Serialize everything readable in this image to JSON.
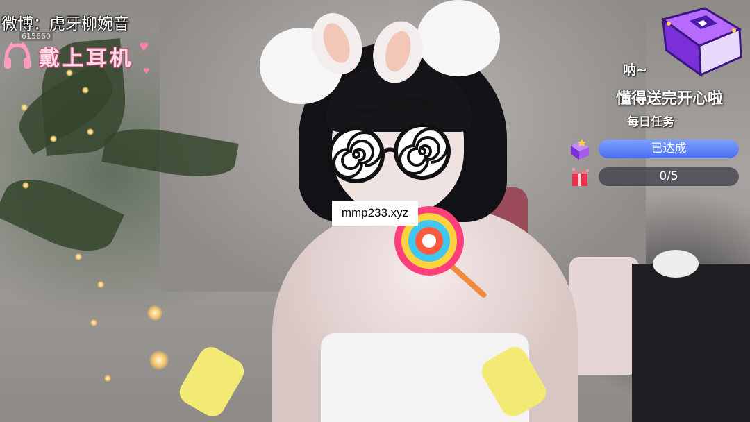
{
  "stream_overlay": {
    "weibo_label": "微博：虎牙柳婉音",
    "room_id_text": "615660",
    "headset_label": "戴上耳机",
    "watermark": "mmp233.xyz"
  },
  "daily_task": {
    "exclaim": "呐~",
    "message": "懂得送完开心啦",
    "title": "每日任务",
    "task1_status": "已达成",
    "task2_progress": "0/5",
    "task2_done": 0,
    "task2_total": 5
  },
  "colors": {
    "accent_blue": "#4a6ef0",
    "headset_pink": "#ff9cc0",
    "book_purple": "#8a3fe0"
  },
  "icons": {
    "headphone": "pink-headphone-icon",
    "book": "purple-gift-book-icon",
    "task1": "purple-gift-icon",
    "task2": "red-gift-icon"
  }
}
